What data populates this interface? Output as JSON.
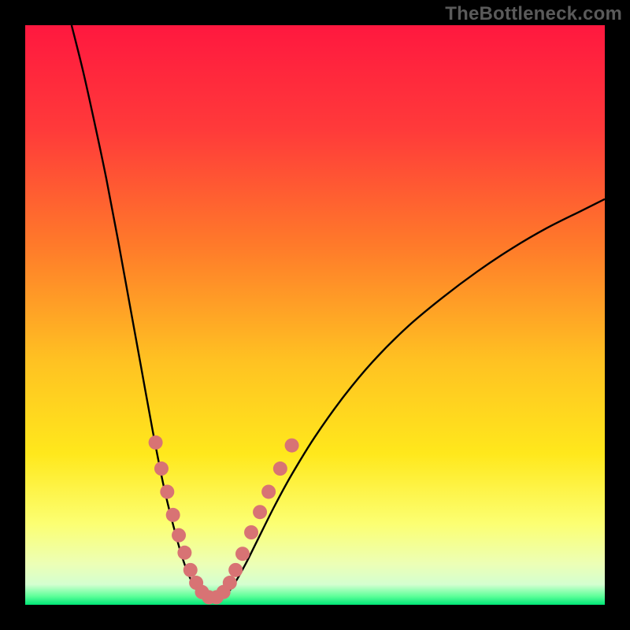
{
  "watermark": "TheBottleneck.com",
  "chart_data": {
    "type": "line",
    "title": "",
    "xlabel": "",
    "ylabel": "",
    "xlim": [
      0,
      100
    ],
    "ylim": [
      0,
      100
    ],
    "gradient_stops": [
      {
        "offset": 0.0,
        "color": "#ff183f"
      },
      {
        "offset": 0.18,
        "color": "#ff3a3a"
      },
      {
        "offset": 0.38,
        "color": "#ff7a2a"
      },
      {
        "offset": 0.58,
        "color": "#ffc222"
      },
      {
        "offset": 0.74,
        "color": "#ffe81c"
      },
      {
        "offset": 0.86,
        "color": "#fcff72"
      },
      {
        "offset": 0.93,
        "color": "#ecffb6"
      },
      {
        "offset": 0.965,
        "color": "#d4ffd0"
      },
      {
        "offset": 0.985,
        "color": "#5fff9a"
      },
      {
        "offset": 1.0,
        "color": "#00e676"
      }
    ],
    "series": [
      {
        "name": "bottleneck-curve",
        "color": "#000000",
        "stroke_width": 2.4,
        "points": [
          {
            "x": 8.0,
            "y": 100.0
          },
          {
            "x": 10.0,
            "y": 92.0
          },
          {
            "x": 12.0,
            "y": 83.0
          },
          {
            "x": 14.0,
            "y": 73.5
          },
          {
            "x": 16.0,
            "y": 63.0
          },
          {
            "x": 18.0,
            "y": 52.0
          },
          {
            "x": 20.0,
            "y": 41.0
          },
          {
            "x": 22.0,
            "y": 30.0
          },
          {
            "x": 24.0,
            "y": 20.0
          },
          {
            "x": 26.0,
            "y": 12.0
          },
          {
            "x": 27.5,
            "y": 7.0
          },
          {
            "x": 29.0,
            "y": 3.5
          },
          {
            "x": 30.5,
            "y": 1.6
          },
          {
            "x": 32.0,
            "y": 1.0
          },
          {
            "x": 33.0,
            "y": 1.0
          },
          {
            "x": 34.5,
            "y": 1.6
          },
          {
            "x": 36.0,
            "y": 3.5
          },
          {
            "x": 38.0,
            "y": 7.0
          },
          {
            "x": 40.0,
            "y": 11.0
          },
          {
            "x": 43.0,
            "y": 17.0
          },
          {
            "x": 46.0,
            "y": 22.5
          },
          {
            "x": 50.0,
            "y": 29.0
          },
          {
            "x": 55.0,
            "y": 36.0
          },
          {
            "x": 60.0,
            "y": 42.0
          },
          {
            "x": 66.0,
            "y": 48.0
          },
          {
            "x": 72.0,
            "y": 53.0
          },
          {
            "x": 78.0,
            "y": 57.5
          },
          {
            "x": 84.0,
            "y": 61.5
          },
          {
            "x": 90.0,
            "y": 65.0
          },
          {
            "x": 96.0,
            "y": 68.0
          },
          {
            "x": 100.0,
            "y": 70.0
          }
        ]
      }
    ],
    "markers": {
      "name": "highlight-dots",
      "color": "#d87374",
      "radius": 9,
      "points": [
        {
          "x": 22.5,
          "y": 28.0
        },
        {
          "x": 23.5,
          "y": 23.5
        },
        {
          "x": 24.5,
          "y": 19.5
        },
        {
          "x": 25.5,
          "y": 15.5
        },
        {
          "x": 26.5,
          "y": 12.0
        },
        {
          "x": 27.5,
          "y": 9.0
        },
        {
          "x": 28.5,
          "y": 6.0
        },
        {
          "x": 29.5,
          "y": 3.8
        },
        {
          "x": 30.5,
          "y": 2.2
        },
        {
          "x": 31.7,
          "y": 1.3
        },
        {
          "x": 33.0,
          "y": 1.3
        },
        {
          "x": 34.2,
          "y": 2.2
        },
        {
          "x": 35.3,
          "y": 3.8
        },
        {
          "x": 36.3,
          "y": 6.0
        },
        {
          "x": 37.5,
          "y": 8.8
        },
        {
          "x": 39.0,
          "y": 12.5
        },
        {
          "x": 40.5,
          "y": 16.0
        },
        {
          "x": 42.0,
          "y": 19.5
        },
        {
          "x": 44.0,
          "y": 23.5
        },
        {
          "x": 46.0,
          "y": 27.5
        }
      ]
    }
  }
}
